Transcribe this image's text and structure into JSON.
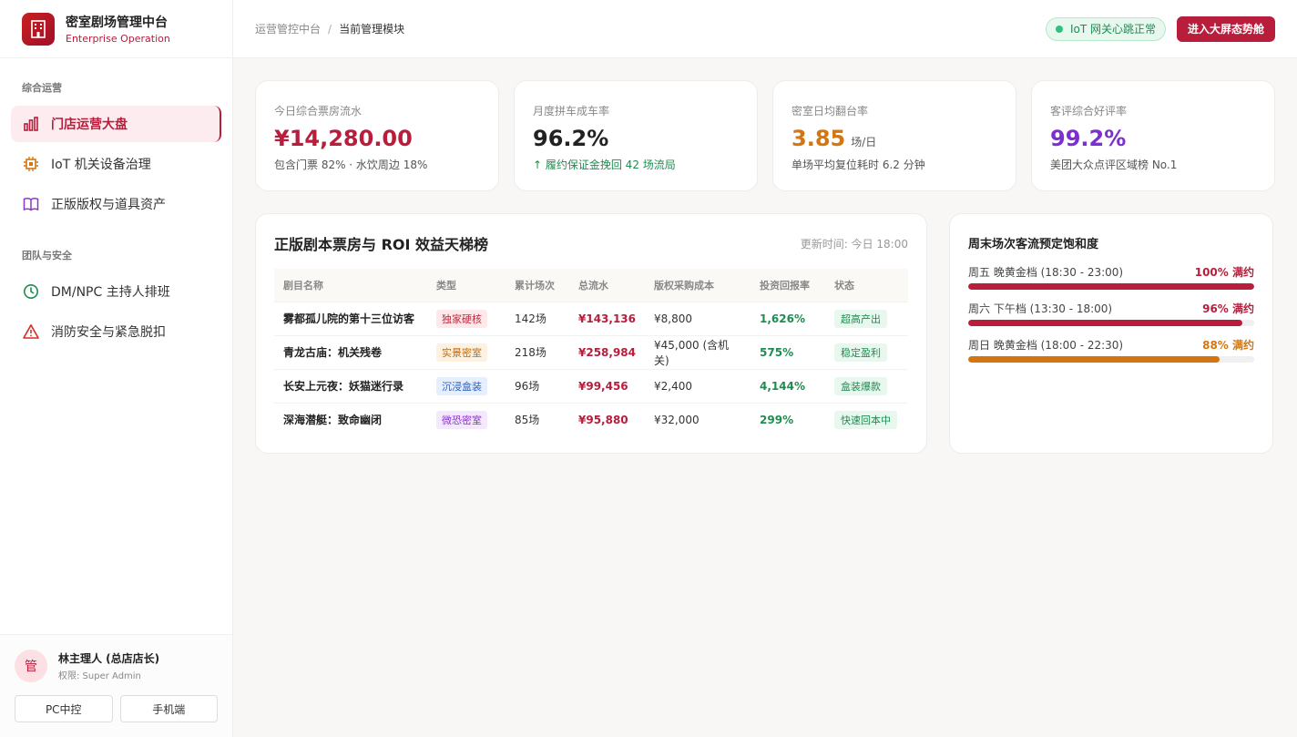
{
  "brand": {
    "title": "密室剧场管理中台",
    "subtitle": "Enterprise Operation"
  },
  "nav": {
    "section1": "综合运营",
    "items1": [
      {
        "label": "门店运营大盘",
        "icon": "bar-chart-icon"
      },
      {
        "label": "IoT 机关设备治理",
        "icon": "chip-icon"
      },
      {
        "label": "正版版权与道具资产",
        "icon": "book-icon"
      }
    ],
    "section2": "团队与安全",
    "items2": [
      {
        "label": "DM/NPC 主持人排班",
        "icon": "clock-icon"
      },
      {
        "label": "消防安全与紧急脱扣",
        "icon": "warning-icon"
      }
    ]
  },
  "user": {
    "avatar": "管",
    "name": "林主理人 (总店店长)",
    "role": "权限: Super Admin"
  },
  "footer": {
    "pc_label": "PC中控",
    "mobile_label": "手机端"
  },
  "breadcrumb": {
    "parent": "运营管控中台",
    "sep": "/",
    "current": "当前管理模块"
  },
  "topbar": {
    "iot_status": "IoT 网关心跳正常",
    "big_screen_label": "进入大屏态势舱"
  },
  "stats": [
    {
      "label": "今日综合票房流水",
      "value": "¥14,280.00",
      "unit": "",
      "sub": "包含门票 82% · 水饮周边 18%",
      "color": "#b81d3c",
      "sub_color": "#555"
    },
    {
      "label": "月度拼车成车率",
      "value": "96.2%",
      "unit": "",
      "sub": "↑ 履约保证金挽回 42 场流局",
      "color": "#222",
      "sub_color": "#1f8c50"
    },
    {
      "label": "密室日均翻台率",
      "value": "3.85",
      "unit": "场/日",
      "sub": "单场平均复位耗时 6.2 分钟",
      "color": "#d4760f",
      "sub_color": "#555"
    },
    {
      "label": "客评综合好评率",
      "value": "99.2%",
      "unit": "",
      "sub": "美团大众点评区域榜 No.1",
      "color": "#7b2fd0",
      "sub_color": "#555"
    }
  ],
  "roi": {
    "title": "正版剧本票房与 ROI 效益天梯榜",
    "updated": "更新时间: 今日 18:00",
    "columns": [
      "剧目名称",
      "类型",
      "累计场次",
      "总流水",
      "版权采购成本",
      "投资回报率",
      "状态"
    ],
    "rows": [
      {
        "name": "雾都孤儿院的第十三位访客",
        "type": "独家硬核",
        "type_bg": "#fde8ea",
        "type_fg": "#c0283f",
        "sessions": "142场",
        "revenue": "¥143,136",
        "cost": "¥8,800",
        "roi": "1,626%",
        "status": "超高产出"
      },
      {
        "name": "青龙古庙：机关残卷",
        "type": "实景密室",
        "type_bg": "#fdf1e1",
        "type_fg": "#c06a12",
        "sessions": "218场",
        "revenue": "¥258,984",
        "cost": "¥45,000 (含机关)",
        "roi": "575%",
        "status": "稳定盈利"
      },
      {
        "name": "长安上元夜：妖猫迷行录",
        "type": "沉浸盒装",
        "type_bg": "#e6effd",
        "type_fg": "#2b62c8",
        "sessions": "96场",
        "revenue": "¥99,456",
        "cost": "¥2,400",
        "roi": "4,144%",
        "status": "盒装爆款"
      },
      {
        "name": "深海潜艇：致命幽闭",
        "type": "微恐密室",
        "type_bg": "#f4e8fd",
        "type_fg": "#8a35c8",
        "sessions": "85场",
        "revenue": "¥95,880",
        "cost": "¥32,000",
        "roi": "299%",
        "status": "快速回本中"
      }
    ]
  },
  "saturation": {
    "title": "周末场次客流预定饱和度",
    "bars": [
      {
        "label": "周五 晚黄金档 (18:30 - 23:00)",
        "pct_label": "100% 满约",
        "value": 100,
        "color": "#b81d3c"
      },
      {
        "label": "周六 下午档 (13:30 - 18:00)",
        "pct_label": "96% 满约",
        "value": 96,
        "color": "#b81d3c"
      },
      {
        "label": "周日 晚黄金档 (18:00 - 22:30)",
        "pct_label": "88% 满约",
        "value": 88,
        "color": "#d4760f"
      }
    ]
  }
}
